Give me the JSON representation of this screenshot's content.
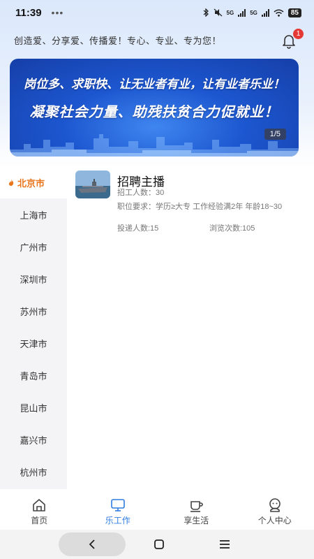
{
  "status_bar": {
    "time": "11:39",
    "dots": "•••",
    "network_1": "5G",
    "network_2": "5G",
    "battery": "85"
  },
  "header": {
    "slogan": "创造爱、分享爱、传播爱！专心、专业、专为您！",
    "notification_count": "1"
  },
  "banner": {
    "line1": "岗位多、求职快、让无业者有业，让有业者乐业！",
    "line2": "凝聚社会力量、助残扶贫合力促就业！",
    "counter": "1/5"
  },
  "sidebar": {
    "items": [
      {
        "label": "北京市"
      },
      {
        "label": "上海市"
      },
      {
        "label": "广州市"
      },
      {
        "label": "深圳市"
      },
      {
        "label": "苏州市"
      },
      {
        "label": "天津市"
      },
      {
        "label": "青岛市"
      },
      {
        "label": "昆山市"
      },
      {
        "label": "嘉兴市"
      },
      {
        "label": "杭州市"
      }
    ]
  },
  "job": {
    "title": "招聘主播",
    "headcount": "招工人数：30",
    "requirements": "职位要求：学历≥大专 工作经验满2年 年龄18~30",
    "applicants": "投递人数:15",
    "views": "浏览次数:105"
  },
  "tabbar": {
    "tabs": [
      {
        "label": "首页"
      },
      {
        "label": "乐工作"
      },
      {
        "label": "享生活"
      },
      {
        "label": "个人中心"
      }
    ]
  },
  "colors": {
    "accent": "#2f7de1",
    "active_city": "#e8751a",
    "badge": "#e53935"
  }
}
